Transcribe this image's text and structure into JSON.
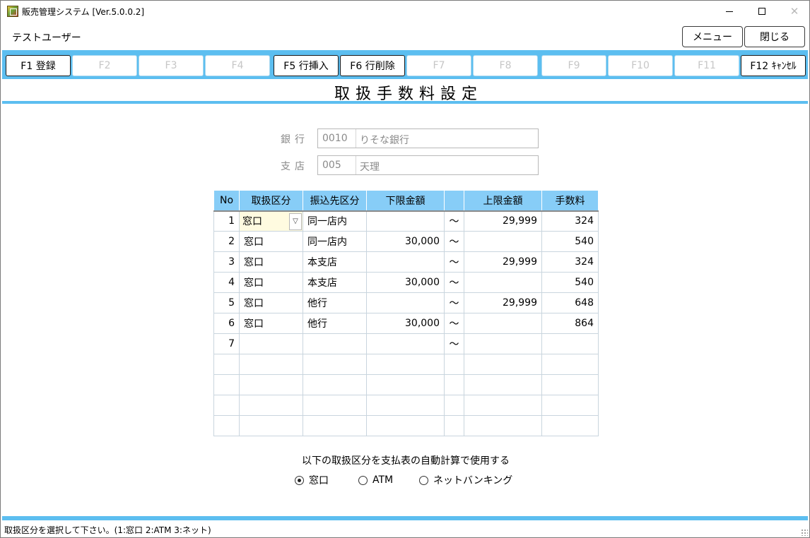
{
  "window": {
    "title": "販売管理システム [Ver.5.0.0.2]"
  },
  "header": {
    "user_name": "テストユーザー",
    "menu_button": "メニュー",
    "close_button": "閉じる"
  },
  "fkeys": [
    {
      "label": "F1 登録",
      "enabled": true
    },
    {
      "label": "F2",
      "enabled": false
    },
    {
      "label": "F3",
      "enabled": false
    },
    {
      "label": "F4",
      "enabled": false
    },
    {
      "label": "F5 行挿入",
      "enabled": true
    },
    {
      "label": "F6 行削除",
      "enabled": true
    },
    {
      "label": "F7",
      "enabled": false
    },
    {
      "label": "F8",
      "enabled": false
    },
    {
      "label": "F9",
      "enabled": false
    },
    {
      "label": "F10",
      "enabled": false
    },
    {
      "label": "F11",
      "enabled": false
    },
    {
      "label": "F12 ｷｬﾝｾﾙ",
      "enabled": true
    }
  ],
  "screen_title": "取扱手数料設定",
  "bank": {
    "label": "銀行",
    "code": "0010",
    "name": "りそな銀行"
  },
  "branch": {
    "label": "支店",
    "code": "005",
    "name": "天理"
  },
  "grid": {
    "headers": [
      "No",
      "取扱区分",
      "振込先区分",
      "下限金額",
      "",
      "上限金額",
      "手数料"
    ],
    "rows": [
      {
        "no": "1",
        "kind": "窓口",
        "dest": "同一店内",
        "lower": "",
        "tilde": "～",
        "upper": "29,999",
        "fee": "324"
      },
      {
        "no": "2",
        "kind": "窓口",
        "dest": "同一店内",
        "lower": "30,000",
        "tilde": "～",
        "upper": "",
        "fee": "540"
      },
      {
        "no": "3",
        "kind": "窓口",
        "dest": "本支店",
        "lower": "",
        "tilde": "～",
        "upper": "29,999",
        "fee": "324"
      },
      {
        "no": "4",
        "kind": "窓口",
        "dest": "本支店",
        "lower": "30,000",
        "tilde": "～",
        "upper": "",
        "fee": "540"
      },
      {
        "no": "5",
        "kind": "窓口",
        "dest": "他行",
        "lower": "",
        "tilde": "～",
        "upper": "29,999",
        "fee": "648"
      },
      {
        "no": "6",
        "kind": "窓口",
        "dest": "他行",
        "lower": "30,000",
        "tilde": "～",
        "upper": "",
        "fee": "864"
      },
      {
        "no": "7",
        "kind": "",
        "dest": "",
        "lower": "",
        "tilde": "～",
        "upper": "",
        "fee": ""
      },
      {
        "no": "",
        "kind": "",
        "dest": "",
        "lower": "",
        "tilde": "",
        "upper": "",
        "fee": ""
      },
      {
        "no": "",
        "kind": "",
        "dest": "",
        "lower": "",
        "tilde": "",
        "upper": "",
        "fee": ""
      },
      {
        "no": "",
        "kind": "",
        "dest": "",
        "lower": "",
        "tilde": "",
        "upper": "",
        "fee": ""
      },
      {
        "no": "",
        "kind": "",
        "dest": "",
        "lower": "",
        "tilde": "",
        "upper": "",
        "fee": ""
      }
    ]
  },
  "auto_calc": {
    "caption": "以下の取扱区分を支払表の自動計算で使用する",
    "options": [
      {
        "label": "窓口",
        "checked": true
      },
      {
        "label": "ATM",
        "checked": false
      },
      {
        "label": "ネットバンキング",
        "checked": false
      }
    ]
  },
  "status_bar": {
    "message": "取扱区分を選択して下さい。(1:窓口 2:ATM 3:ネット)"
  },
  "colors": {
    "accent_blue": "#5cbef0",
    "header_blue": "#87cdf7",
    "active_cell": "#fffbe0"
  }
}
